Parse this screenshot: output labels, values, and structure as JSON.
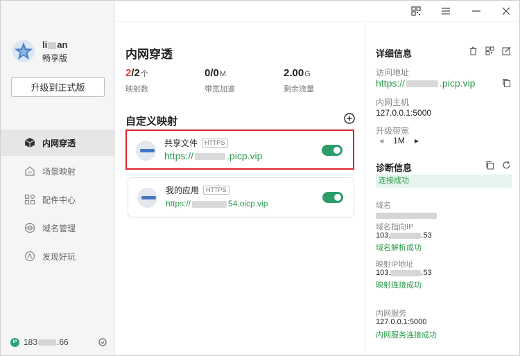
{
  "user": {
    "name_prefix": "li",
    "name_suffix": "an",
    "plan": "畅享版"
  },
  "sidebar": {
    "upgrade_label": "升级到正式版",
    "items": [
      {
        "label": "内网穿透",
        "icon": "cube-icon",
        "active": true
      },
      {
        "label": "场景映射",
        "icon": "house-icon",
        "active": false
      },
      {
        "label": "配件中心",
        "icon": "grid-icon",
        "active": false
      },
      {
        "label": "域名管理",
        "icon": "globe-icon",
        "active": false
      },
      {
        "label": "发现好玩",
        "icon": "compass-icon",
        "active": false
      }
    ],
    "ip_prefix": "183",
    "ip_suffix": ".66"
  },
  "main": {
    "title": "内网穿透",
    "stats": [
      {
        "value_accent": "2",
        "value_rest": "/2",
        "unit": "个",
        "label": "映射数"
      },
      {
        "value_accent": "",
        "value_rest": "0/0",
        "unit": "M",
        "label": "带宽加速"
      },
      {
        "value_accent": "",
        "value_rest": "2.00",
        "unit": "G",
        "label": "剩余流量"
      }
    ],
    "section_title": "自定义映射",
    "mappings": [
      {
        "name": "共享文件",
        "protocol": "HTTPS",
        "url_prefix": "https://",
        "url_suffix": ".picp.vip",
        "enabled": true
      },
      {
        "name": "我的应用",
        "protocol": "HTTPS",
        "url_prefix": "https://",
        "url_suffix": "54.oicp.vip",
        "enabled": true
      }
    ]
  },
  "detail": {
    "title": "详细信息",
    "access_label": "访问地址",
    "access_prefix": "https://",
    "access_suffix": ".picp.vip",
    "host_label": "内网主机",
    "host_value": "127.0.0.1:5000",
    "bandwidth_label": "升级带宽",
    "bandwidth_value": "1M",
    "diag_title": "诊断信息",
    "conn_status": "连接成功",
    "domain_label": "域名",
    "domain_ip_label": "域名指向IP",
    "domain_ip_prefix": "103.",
    "domain_ip_suffix": ".53",
    "domain_ok": "域名解析成功",
    "map_ip_label": "映射IP地址",
    "map_ip_prefix": "103.",
    "map_ip_suffix": ".53",
    "map_ok": "映射连接成功",
    "service_label": "内网服务",
    "service_value": "127.0.0.1:5000",
    "service_ok": "内网服务连接成功"
  }
}
